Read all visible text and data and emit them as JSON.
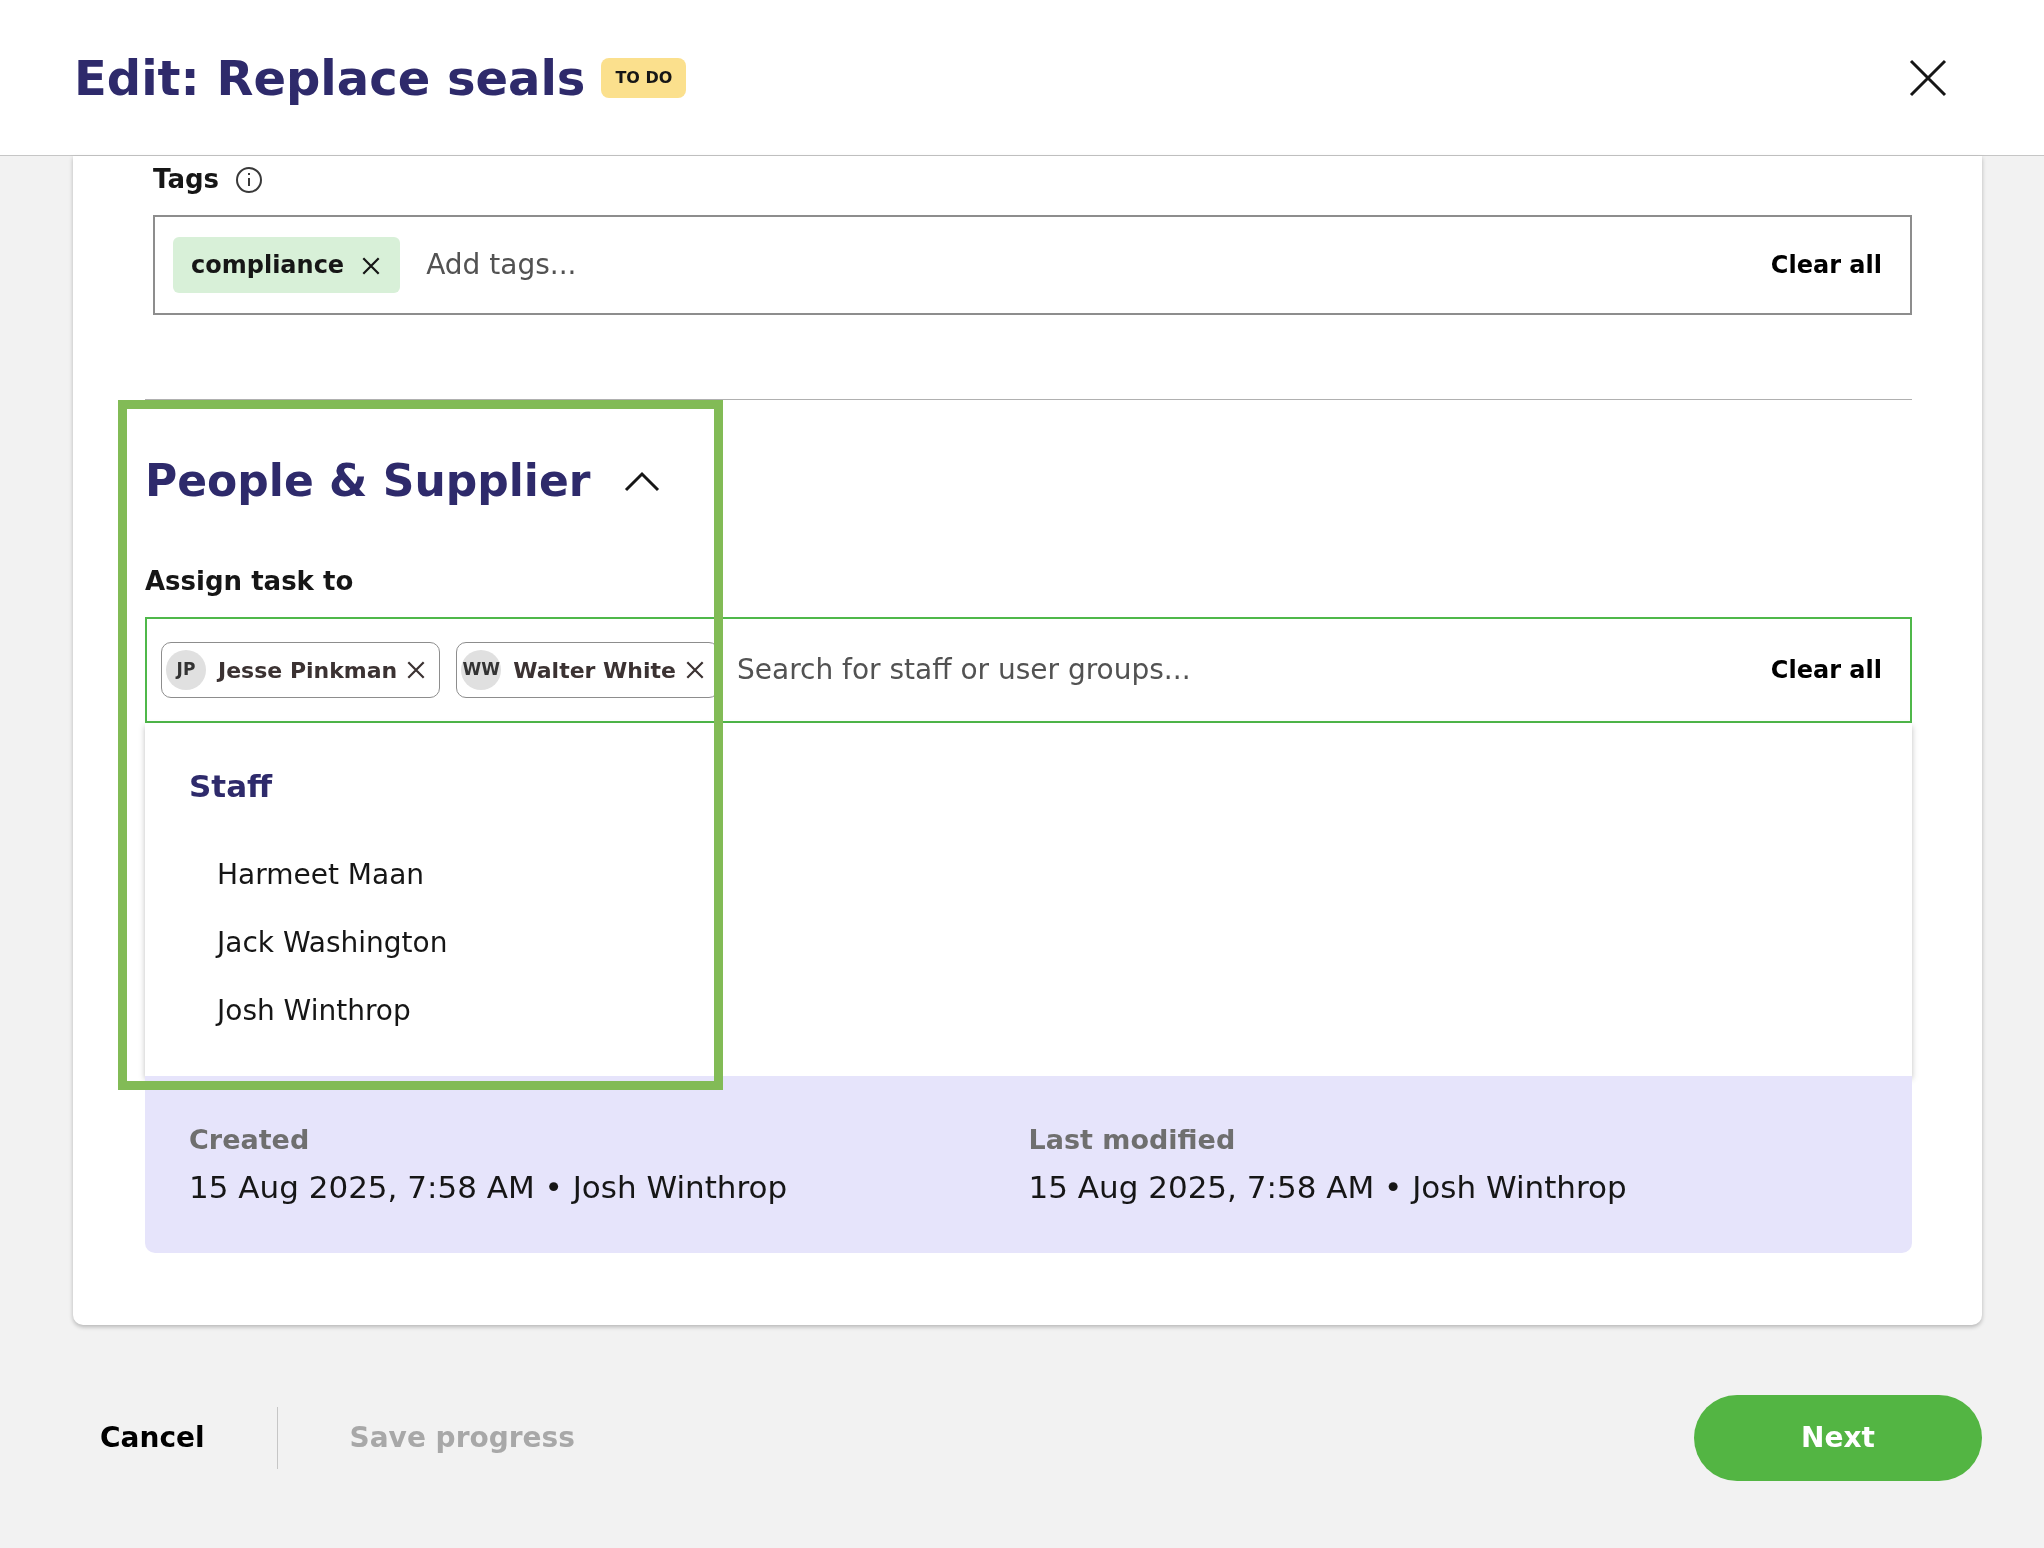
{
  "header": {
    "title": "Edit: Replace seals",
    "status_badge": "TO DO"
  },
  "tags": {
    "label": "Tags",
    "chips": [
      {
        "label": "compliance"
      }
    ],
    "placeholder": "Add tags...",
    "clear_label": "Clear all"
  },
  "section": {
    "title": "People & Supplier",
    "expanded": true
  },
  "assign": {
    "label": "Assign task to",
    "chips": [
      {
        "initials": "JP",
        "name": "Jesse Pinkman"
      },
      {
        "initials": "WW",
        "name": "Walter White"
      }
    ],
    "placeholder": "Search for staff or user groups...",
    "clear_label": "Clear all"
  },
  "dropdown": {
    "group": "Staff",
    "options": [
      "Harmeet Maan",
      "Jack Washington",
      "Josh Winthrop"
    ]
  },
  "info": [
    {
      "label": "Created",
      "value": "15 Aug 2025, 7:58 AM • Josh Winthrop"
    },
    {
      "label": "Last modified",
      "value": "15 Aug 2025, 7:58 AM • Josh Winthrop"
    }
  ],
  "footer": {
    "cancel": "Cancel",
    "save": "Save progress",
    "save_disabled": true,
    "next": "Next"
  },
  "highlight": true
}
